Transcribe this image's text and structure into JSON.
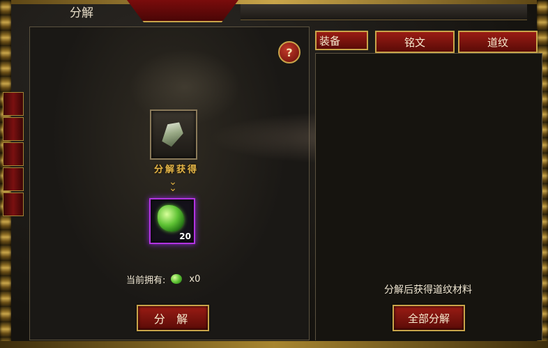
{
  "window": {
    "title": "分解"
  },
  "help_button": {
    "label": "?"
  },
  "source_item": {
    "icon": "crystal-icon"
  },
  "gain_label": "分解获得",
  "result_item": {
    "icon": "green-gem-icon",
    "count": "20"
  },
  "owned": {
    "label": "当前拥有:",
    "value": "x0"
  },
  "decompose_button": {
    "label": "分 解"
  },
  "tabs": [
    {
      "label": "装备"
    },
    {
      "label": "铭文"
    },
    {
      "label": "道纹"
    }
  ],
  "right_panel": {
    "hint": "分解后获得道纹材料",
    "decompose_all_label": "全部分解"
  },
  "colors": {
    "accent_gold": "#c9a54a",
    "button_red": "#9a1c14",
    "result_border_purple": "#b233e0"
  }
}
